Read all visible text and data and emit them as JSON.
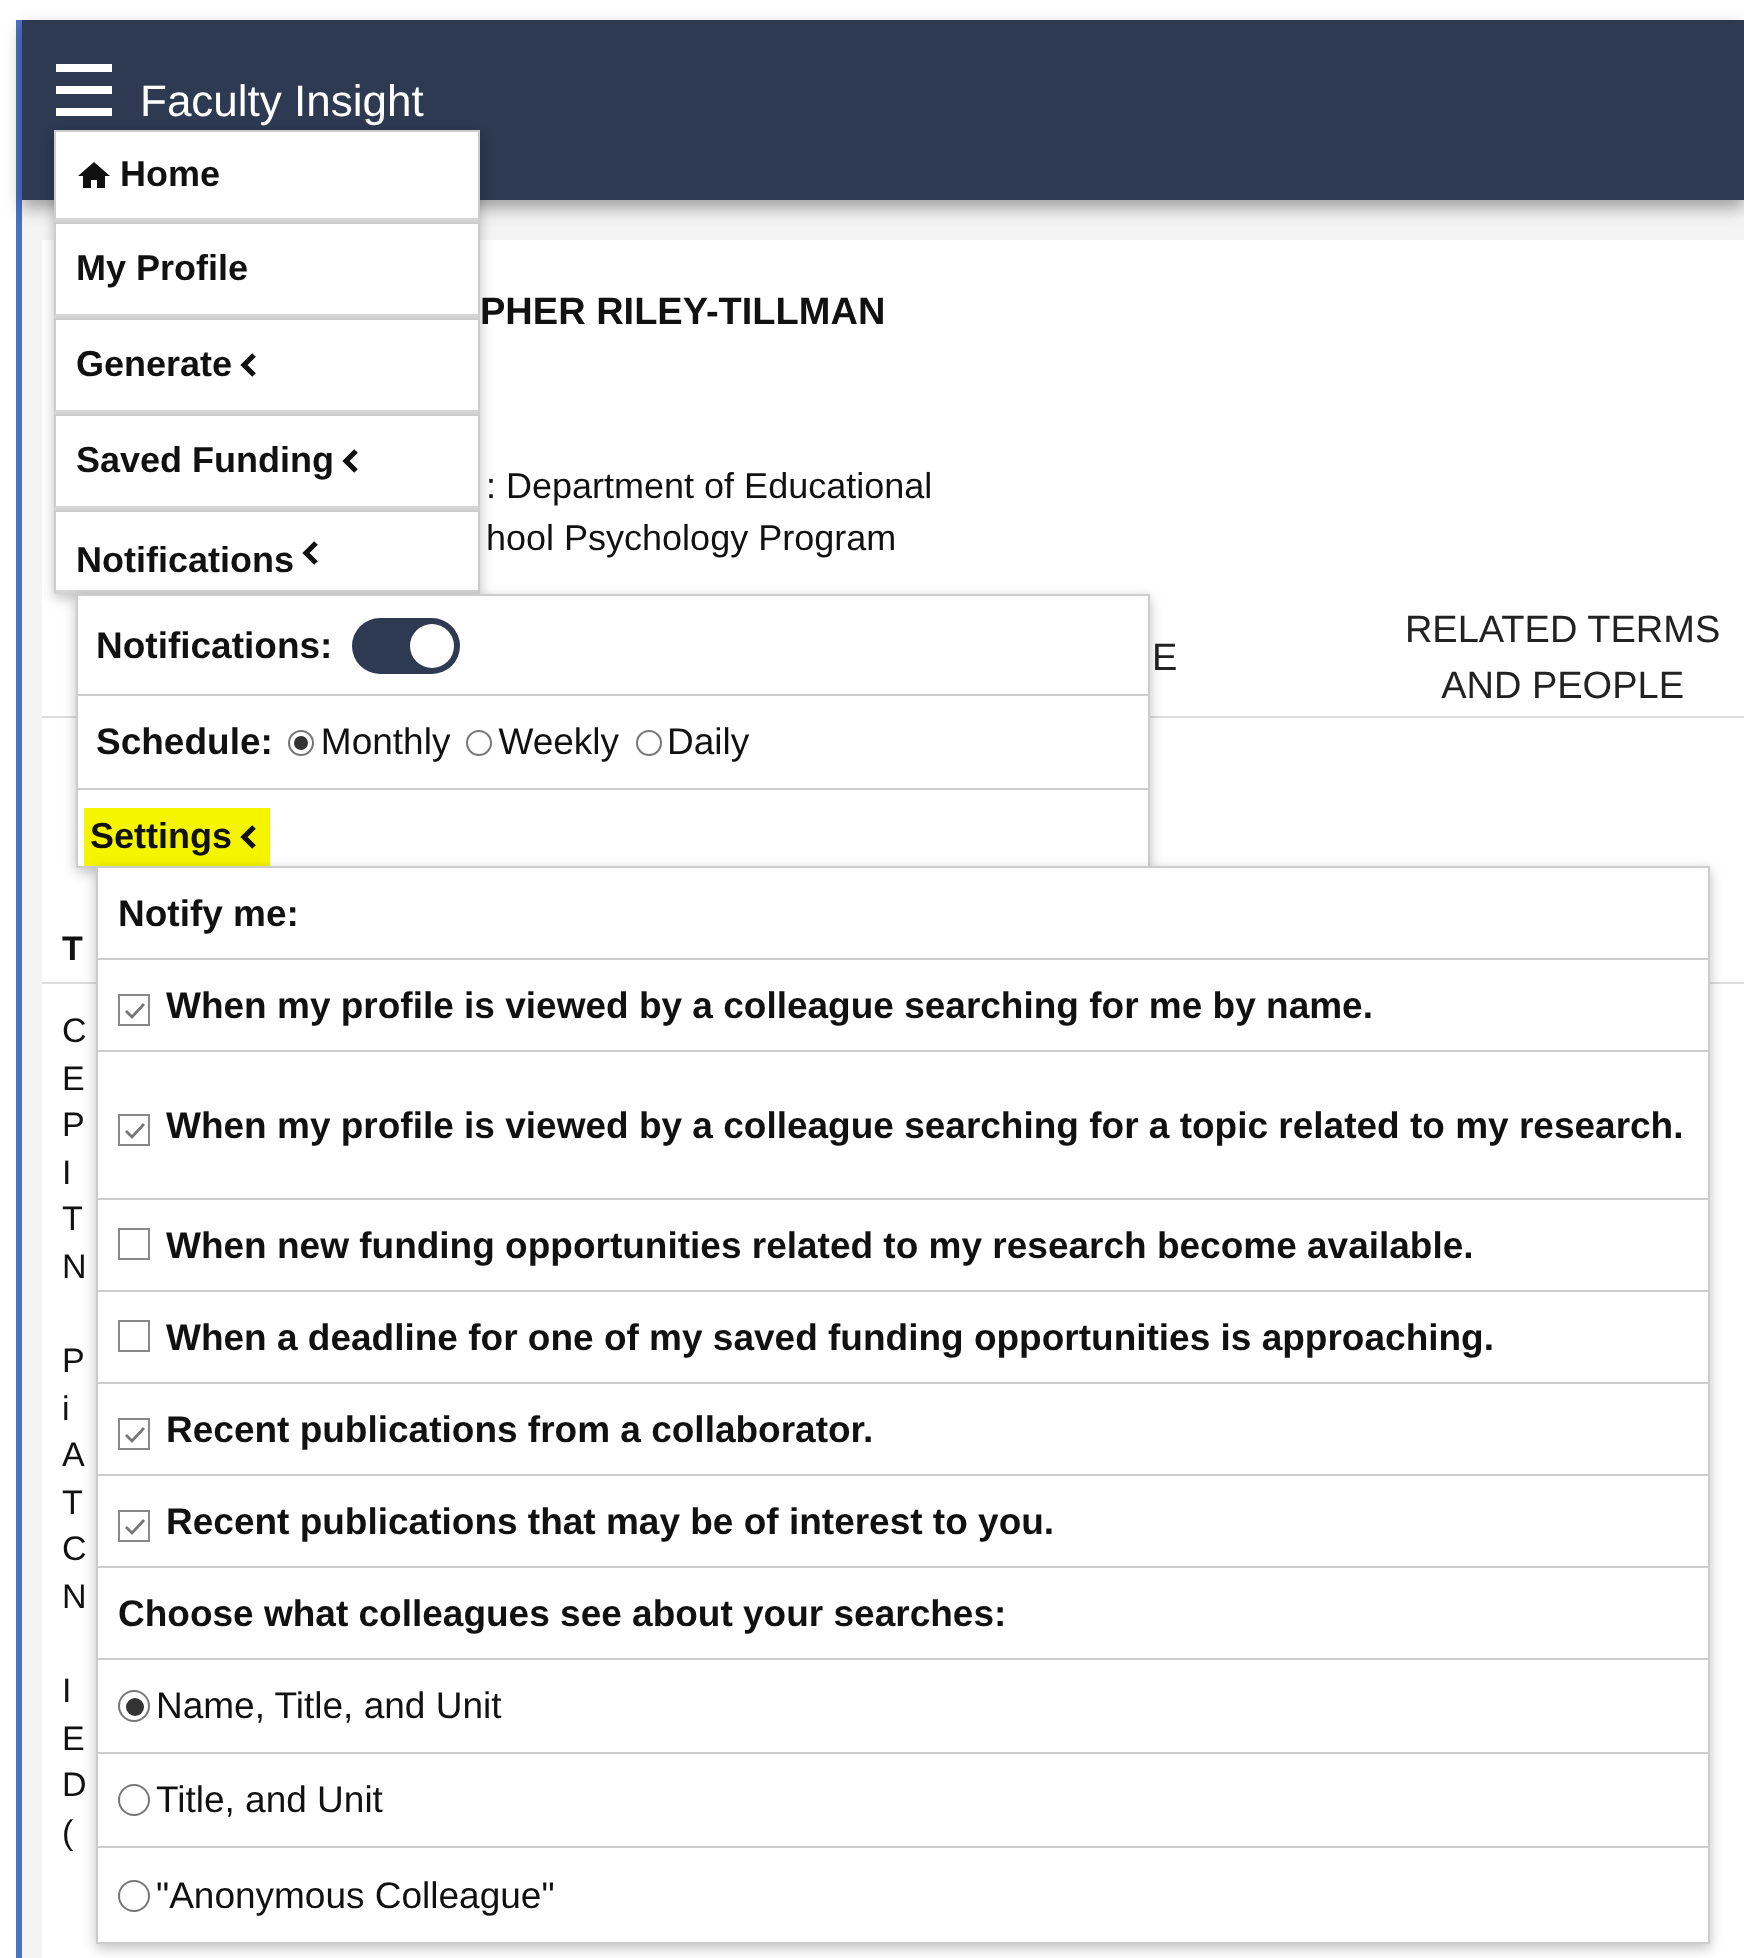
{
  "header": {
    "title": "Faculty Insight"
  },
  "profile": {
    "name": "PHER RILEY-TILLMAN",
    "affiliation_lines": [
      ": Department of Educational",
      "hool Psychology Program"
    ]
  },
  "tabs": [
    {
      "label": "E"
    },
    {
      "label": "RELATED TERMS AND PEOPLE"
    }
  ],
  "section": {
    "heading": "T",
    "paragraphs": [
      [
        "C",
        "E",
        "P",
        "I",
        "T",
        "N"
      ],
      [
        "P",
        "i",
        "A",
        "T",
        "C",
        "N"
      ],
      [
        "I",
        "E",
        "D",
        "("
      ]
    ]
  },
  "menu": {
    "items": [
      {
        "label": "Home",
        "kind": "home",
        "expanded": false
      },
      {
        "label": "My Profile",
        "kind": "link",
        "expanded": false
      },
      {
        "label": "Generate",
        "kind": "submenu",
        "expanded": false
      },
      {
        "label": "Saved Funding",
        "kind": "submenu",
        "expanded": false
      },
      {
        "label": "Notifications",
        "kind": "submenu",
        "expanded": true
      }
    ]
  },
  "notifications_panel": {
    "toggle": {
      "label": "Notifications:",
      "on": true
    },
    "schedule": {
      "label": "Schedule:",
      "options": [
        {
          "label": "Monthly",
          "selected": true
        },
        {
          "label": "Weekly",
          "selected": false
        },
        {
          "label": "Daily",
          "selected": false
        }
      ]
    },
    "settings": {
      "label": "Settings",
      "highlighted": true,
      "expanded": true
    }
  },
  "settings_panel": {
    "heading": "Notify me:",
    "options": [
      {
        "label": "When my profile is viewed by a colleague searching for me by name.",
        "checked": true
      },
      {
        "label": "When my profile is viewed by a colleague searching for a topic related to my research.",
        "checked": true
      },
      {
        "label": "When new funding opportunities related to my research become available.",
        "checked": false
      },
      {
        "label": "When a deadline for one of my saved funding opportunities is approaching.",
        "checked": false
      },
      {
        "label": "Recent publications from a collaborator.",
        "checked": true
      },
      {
        "label": "Recent publications that may be of interest to you.",
        "checked": true
      }
    ],
    "visibility_heading": "Choose what colleagues see about your searches:",
    "visibility_options": [
      {
        "label": "Name, Title, and Unit",
        "selected": true
      },
      {
        "label": "Title, and Unit",
        "selected": false
      },
      {
        "label": "\"Anonymous Colleague\"",
        "selected": false
      }
    ]
  }
}
